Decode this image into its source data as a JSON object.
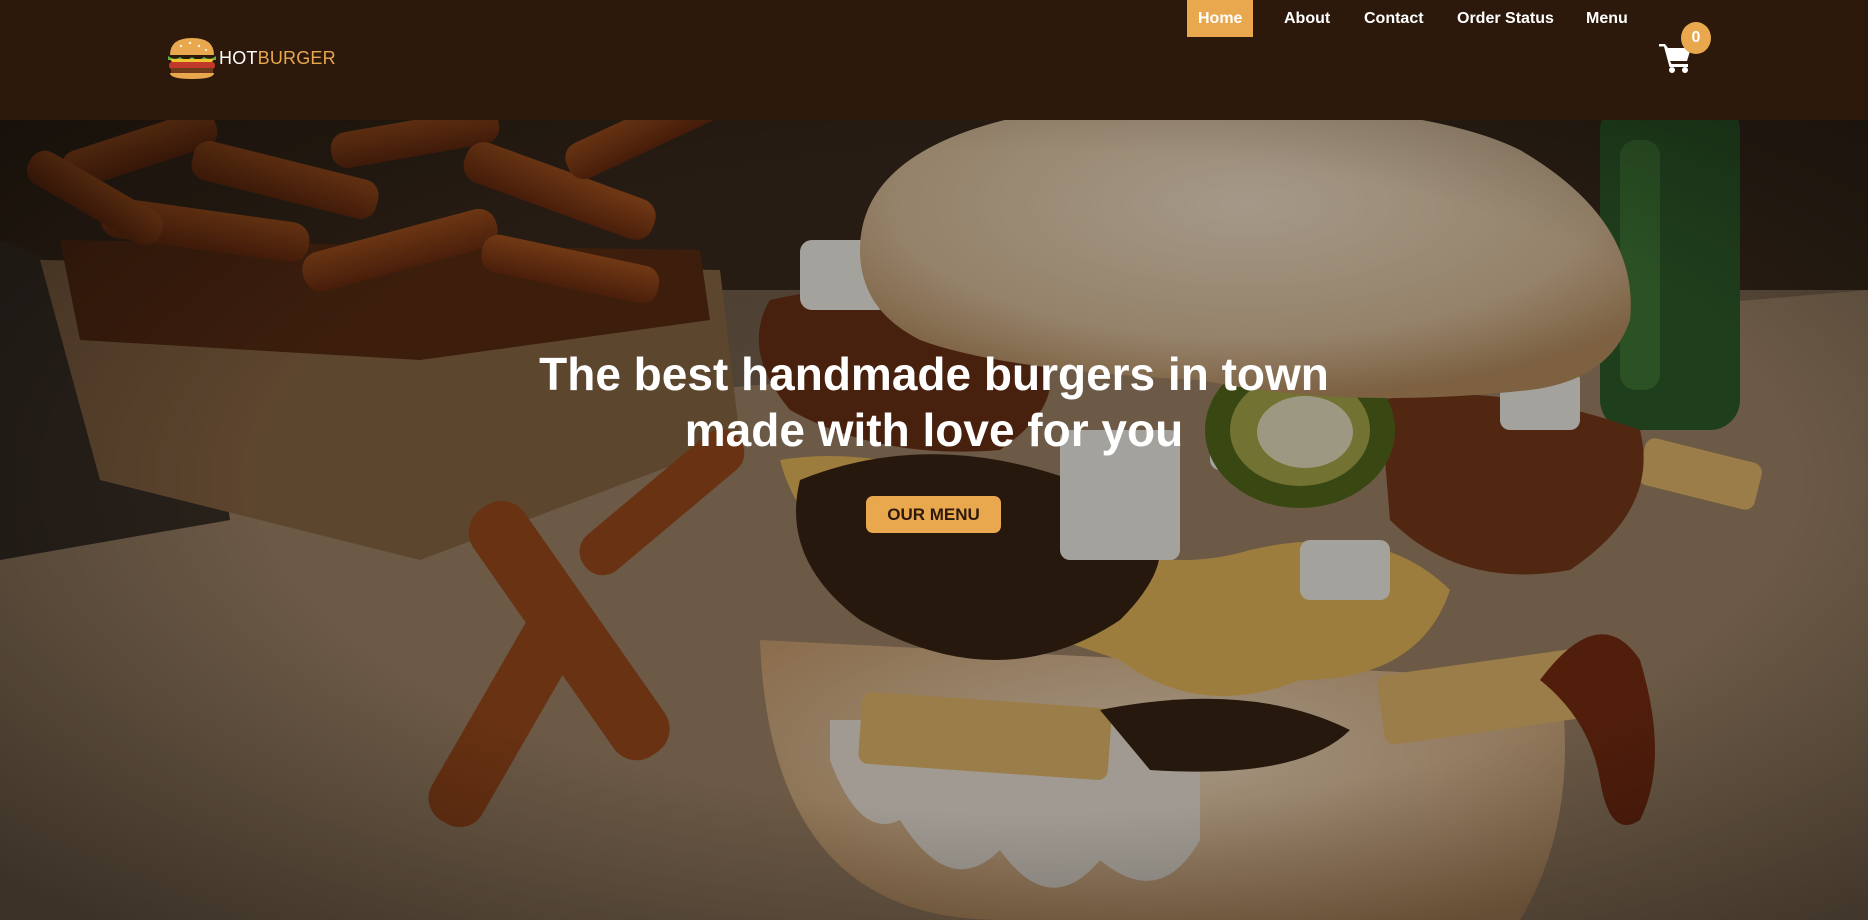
{
  "brand": {
    "name_part1": "HOT",
    "name_part2": "BURGER",
    "logo_icon": "burger-icon"
  },
  "nav": {
    "items": [
      {
        "label": "Home",
        "active": true
      },
      {
        "label": "About",
        "active": false
      },
      {
        "label": "Contact",
        "active": false
      },
      {
        "label": "Order Status",
        "active": false
      },
      {
        "label": "Menu",
        "active": false
      }
    ],
    "cart": {
      "icon": "shopping-cart-icon",
      "count": "0"
    }
  },
  "hero": {
    "title_line1": "The best handmade burgers in town",
    "title_line2": "made with love for you",
    "cta_label": "OUR MENU",
    "background": "burger-with-fries-photo"
  },
  "colors": {
    "navbar_bg": "#2c190c",
    "accent": "#e9a84d",
    "text_light": "#ffffff"
  }
}
